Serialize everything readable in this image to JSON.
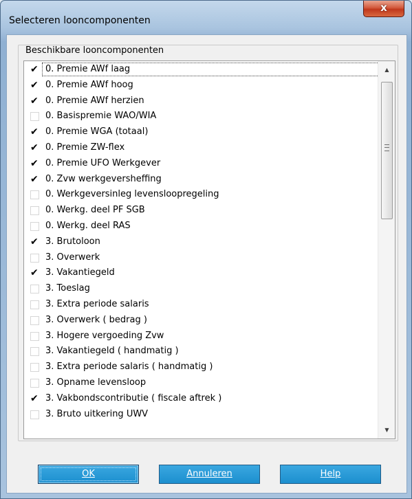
{
  "window": {
    "title": "Selecteren looncomponenten",
    "close_glyph": "x"
  },
  "group": {
    "label": "Beschikbare looncomponenten"
  },
  "items": [
    {
      "label": "0. Premie AWf laag",
      "checked": true
    },
    {
      "label": "0. Premie AWf hoog",
      "checked": true
    },
    {
      "label": "0. Premie AWf herzien",
      "checked": true
    },
    {
      "label": "0. Basispremie WAO/WIA",
      "checked": false
    },
    {
      "label": "0. Premie WGA (totaal)",
      "checked": true
    },
    {
      "label": "0. Premie ZW-flex",
      "checked": true
    },
    {
      "label": "0. Premie UFO Werkgever",
      "checked": true
    },
    {
      "label": "0. Zvw werkgeversheffing",
      "checked": true
    },
    {
      "label": "0. Werkgeversinleg levensloopregeling",
      "checked": false
    },
    {
      "label": "0. Werkg. deel PF SGB",
      "checked": false
    },
    {
      "label": "0. Werkg. deel RAS",
      "checked": false
    },
    {
      "label": "3. Brutoloon",
      "checked": true
    },
    {
      "label": "3. Overwerk",
      "checked": false
    },
    {
      "label": "3. Vakantiegeld",
      "checked": true
    },
    {
      "label": "3. Toeslag",
      "checked": false
    },
    {
      "label": "3. Extra periode salaris",
      "checked": false
    },
    {
      "label": "3. Overwerk ( bedrag )",
      "checked": false
    },
    {
      "label": "3. Hogere vergoeding Zvw",
      "checked": false
    },
    {
      "label": "3. Vakantiegeld ( handmatig )",
      "checked": false
    },
    {
      "label": "3. Extra periode salaris ( handmatig )",
      "checked": false
    },
    {
      "label": "3. Opname levensloop",
      "checked": false
    },
    {
      "label": "3. Vakbondscontributie ( fiscale aftrek )",
      "checked": true
    },
    {
      "label": "3. Bruto uitkering UWV",
      "checked": false
    }
  ],
  "check_glyph": "✔",
  "buttons": {
    "ok": "OK",
    "cancel": "Annuleren",
    "help": "Help"
  },
  "scrollbar": {
    "up_glyph": "▲",
    "down_glyph": "▼"
  }
}
